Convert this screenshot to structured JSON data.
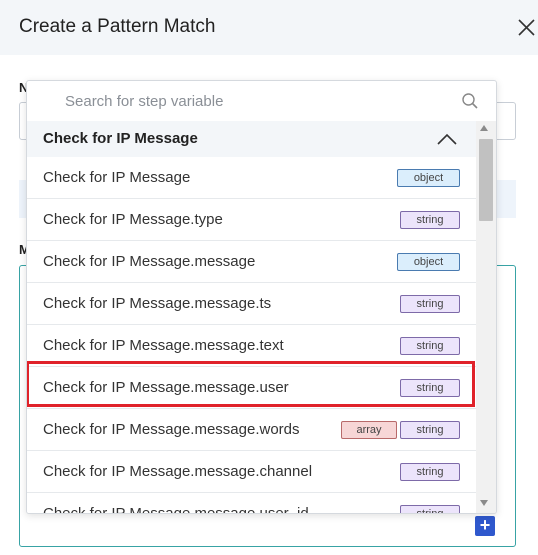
{
  "dialog": {
    "title": "Create a Pattern Match"
  },
  "form": {
    "label_n": "N",
    "label_m": "M",
    "add_button": "+"
  },
  "dropdown": {
    "search_placeholder": "Search for step variable",
    "group_title": "Check for IP Message",
    "items": [
      {
        "label": "Check for IP Message",
        "badges": [
          {
            "text": "object",
            "kind": "object"
          }
        ]
      },
      {
        "label": "Check for IP Message.type",
        "badges": [
          {
            "text": "string",
            "kind": "string"
          }
        ]
      },
      {
        "label": "Check for IP Message.message",
        "badges": [
          {
            "text": "object",
            "kind": "object"
          }
        ]
      },
      {
        "label": "Check for IP Message.message.ts",
        "badges": [
          {
            "text": "string",
            "kind": "string"
          }
        ]
      },
      {
        "label": "Check for IP Message.message.text",
        "badges": [
          {
            "text": "string",
            "kind": "string"
          }
        ]
      },
      {
        "label": "Check for IP Message.message.user",
        "badges": [
          {
            "text": "string",
            "kind": "string"
          }
        ]
      },
      {
        "label": "Check for IP Message.message.words",
        "badges": [
          {
            "text": "array",
            "kind": "array"
          },
          {
            "text": "string",
            "kind": "string"
          }
        ]
      },
      {
        "label": "Check for IP Message.message.channel",
        "badges": [
          {
            "text": "string",
            "kind": "string"
          }
        ]
      },
      {
        "label": "Check for IP Message.message.user_id",
        "badges": [
          {
            "text": "string",
            "kind": "string"
          }
        ]
      }
    ],
    "highlighted_index": 4
  },
  "colors": {
    "highlight": "#e0222a",
    "object_badge": "#dbeefc",
    "string_badge": "#ece4fb",
    "array_badge": "#f7d6d6",
    "add_button": "#2f58cd",
    "textarea_border": "#38a3a5"
  },
  "icons": {
    "close": "close-icon",
    "search": "search-icon",
    "collapse": "chevron-up-icon",
    "add": "plus-icon"
  }
}
